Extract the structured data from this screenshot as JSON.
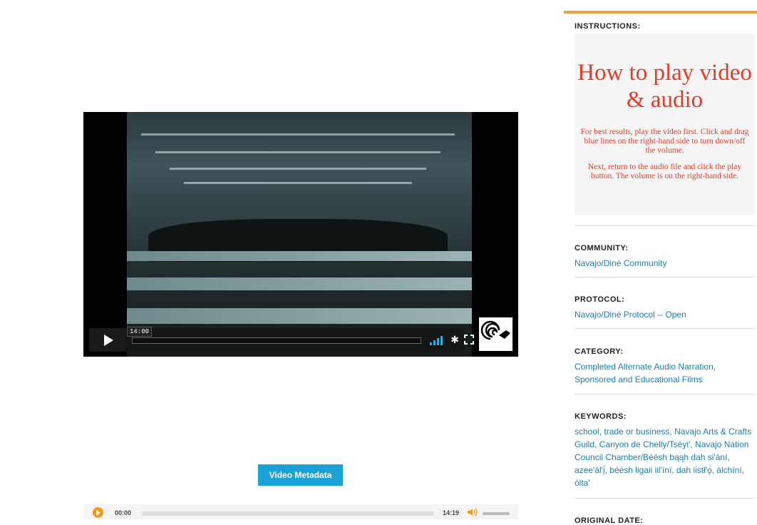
{
  "video": {
    "current_time": "14:00",
    "play_label": "Play"
  },
  "metadata_button": "Video Metadata",
  "audio": {
    "current_time": "00:00",
    "duration": "14:19"
  },
  "sidebar": {
    "instructions_label": "INSTRUCTIONS:",
    "instructions_title": "How to play video & audio",
    "instructions_p1": "For best results, play the video first. Click and drag blue lines on the right-hand side to turn down/off the volume.",
    "instructions_p2": "Next, return to the  audio file and click the play button. The volume is on the right-hand side.",
    "community_label": "COMMUNITY:",
    "community_value": "Navajo/Diné Community",
    "protocol_label": "PROTOCOL:",
    "protocol_value": "Navajo/Diné Protocol -- Open",
    "category_label": "CATEGORY:",
    "category_links": [
      "Completed Alternate Audio Narration",
      "Sponsored and Educational Films"
    ],
    "keywords_label": "KEYWORDS:",
    "keywords": [
      "school",
      "trade or business",
      "Navajo Arts & Crafts Guild",
      "Canyon de Chelly/Tséyi'",
      "Navajo Nation Council Chamber/Béésh bąąh dah si'ání",
      "azee'ál'į́",
      "béésh łigaii iil'íní",
      "dah iistł'ǫ́",
      "álchíní",
      "ólta'"
    ],
    "original_date_label": "ORIGINAL DATE:"
  }
}
